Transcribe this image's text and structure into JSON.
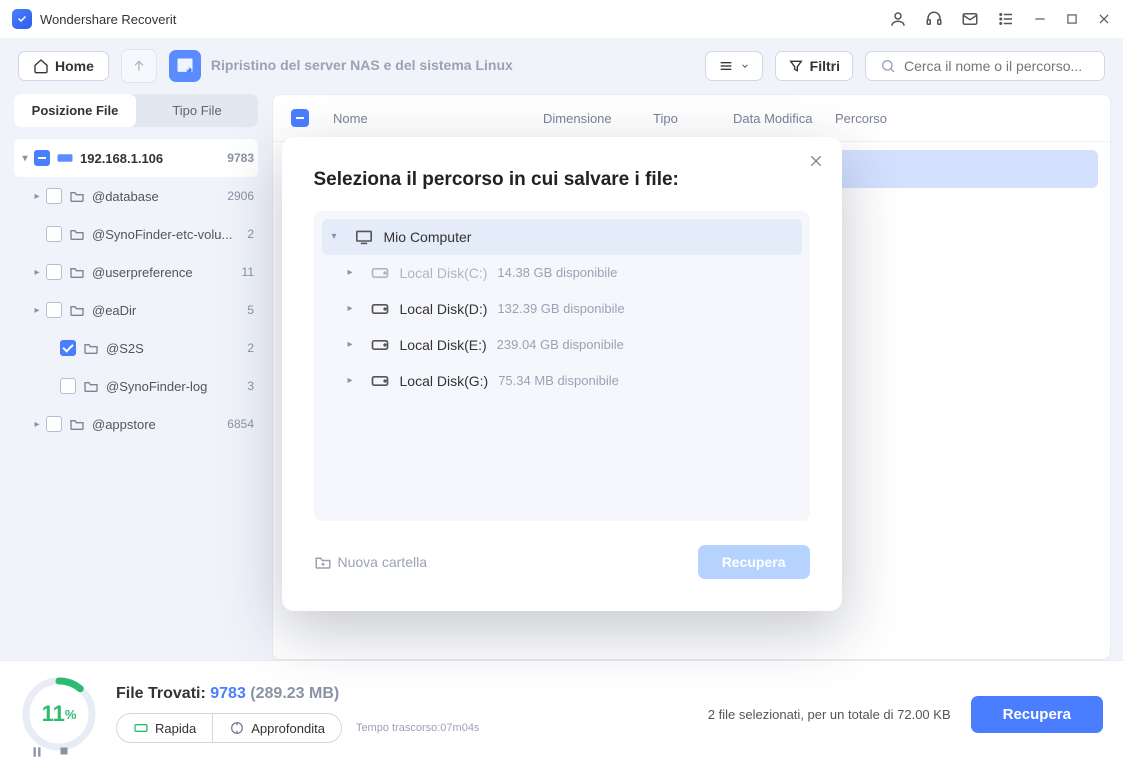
{
  "app_title": "Wondershare Recoverit",
  "toolbar": {
    "home": "Home",
    "path_title": "Ripristino del server NAS e del sistema Linux",
    "filter": "Filtri",
    "search_placeholder": "Cerca il nome o il percorso..."
  },
  "sidebar": {
    "tabs": [
      "Posizione File",
      "Tipo File"
    ],
    "root": {
      "label": "192.168.1.106",
      "count": "9783"
    },
    "items": [
      {
        "label": "@database",
        "count": "2906"
      },
      {
        "label": "@SynoFinder-etc-volu...",
        "count": "2"
      },
      {
        "label": "@userpreference",
        "count": "11"
      },
      {
        "label": "@eaDir",
        "count": "5"
      },
      {
        "label": "@S2S",
        "count": "2"
      },
      {
        "label": "@SynoFinder-log",
        "count": "3"
      },
      {
        "label": "@appstore",
        "count": "6854"
      }
    ]
  },
  "list": {
    "cols": [
      "Nome",
      "Dimensione",
      "Tipo",
      "Data Modifica",
      "Percorso"
    ]
  },
  "footer": {
    "percent": "11",
    "found_label": "File Trovati:",
    "found_count": "9783",
    "found_size": "(289.23 MB)",
    "chips": [
      "Rapida",
      "Approfondita"
    ],
    "elapsed": "Tempo trascorso:07m04s",
    "selected_text": "2 file selezionati, per un totale di 72.00 KB",
    "recover": "Recupera"
  },
  "modal": {
    "title": "Seleziona il percorso in cui salvare i file:",
    "root": "Mio Computer",
    "disks": [
      {
        "label": "Local Disk(C:)",
        "avail": "14.38 GB disponibile"
      },
      {
        "label": "Local Disk(D:)",
        "avail": "132.39 GB disponibile"
      },
      {
        "label": "Local Disk(E:)",
        "avail": "239.04 GB disponibile"
      },
      {
        "label": "Local Disk(G:)",
        "avail": "75.34 MB disponibile"
      }
    ],
    "new_folder": "Nuova cartella",
    "recover": "Recupera"
  }
}
